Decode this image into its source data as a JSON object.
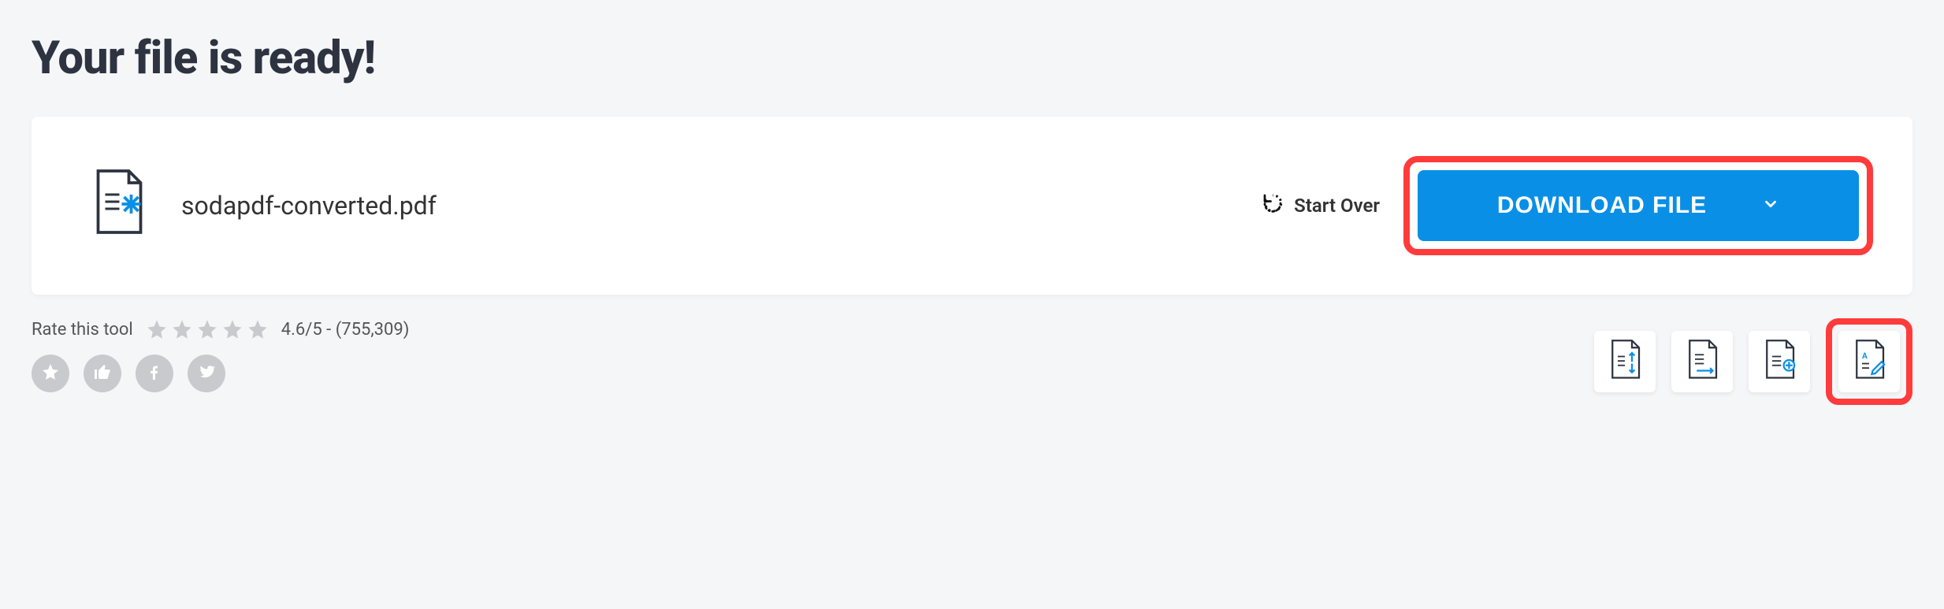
{
  "title": "Your file is ready!",
  "file": {
    "name": "sodapdf-converted.pdf"
  },
  "actions": {
    "start_over": "Start Over",
    "download": "DOWNLOAD FILE"
  },
  "rating": {
    "label": "Rate this tool",
    "score_text": "4.6/5 - (755,309)"
  },
  "colors": {
    "primary": "#0a8fe6",
    "highlight": "#ff3b3b"
  }
}
